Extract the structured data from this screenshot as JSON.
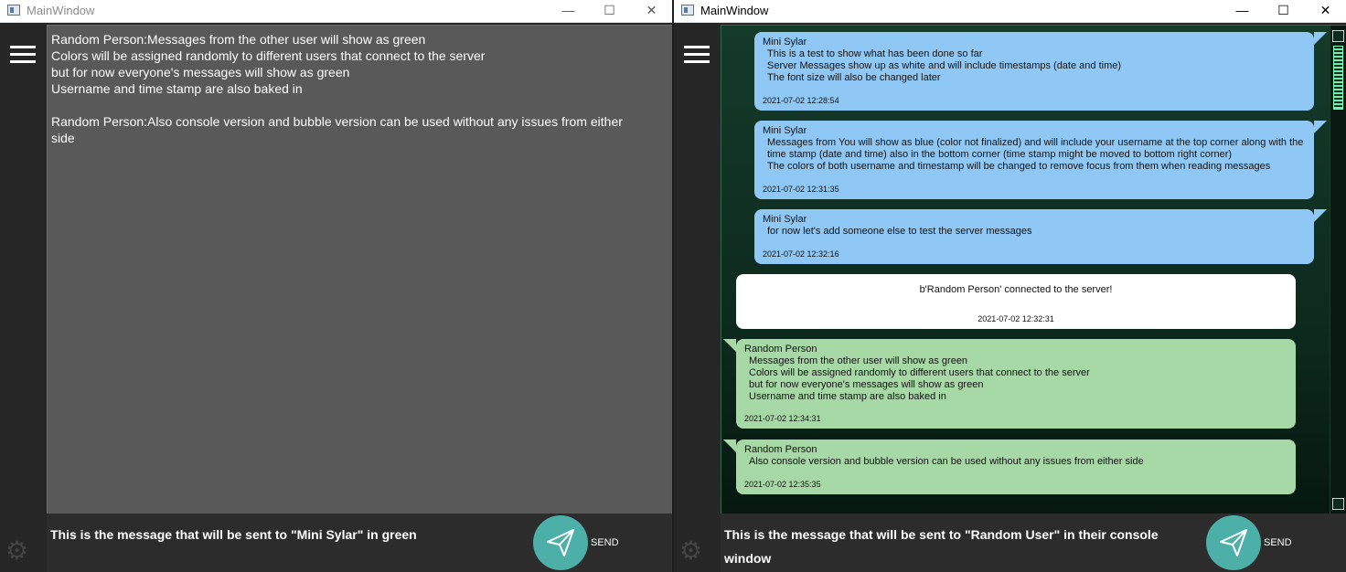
{
  "left_window": {
    "title": "MainWindow",
    "controls": {
      "minimize": "—",
      "maximize": "☐",
      "close": "✕"
    },
    "chat_lines": [
      "Random Person:Messages from the other user will show as green",
      "Colors will be assigned randomly to different users that connect to the server",
      "but for now everyone's messages will show as green",
      "Username and time stamp are also baked in",
      "",
      "Random Person:Also console version and bubble version can be used without any issues from either",
      "side"
    ],
    "input_text": "This is the message that will be sent to \"Mini Sylar\" in green",
    "send_label": "SEND"
  },
  "right_window": {
    "title": "MainWindow",
    "controls": {
      "minimize": "—",
      "maximize": "☐",
      "close": "✕"
    },
    "messages": [
      {
        "type": "own",
        "username": "Mini Sylar",
        "lines": [
          "This is a test to show what has been done so far",
          "Server Messages show up as white and will include timestamps (date and time)",
          "The font size will also be changed later"
        ],
        "timestamp": "2021-07-02 12:28:54"
      },
      {
        "type": "own",
        "username": "Mini Sylar",
        "lines": [
          "Messages from You will show as blue (color not finalized) and will include your username at the top corner along with the",
          "time stamp (date and time) also in the bottom corner (time stamp might be moved to bottom right corner)",
          "The colors of both username and timestamp will be changed to remove focus from them when reading messages"
        ],
        "timestamp": "2021-07-02 12:31:35"
      },
      {
        "type": "own",
        "username": "Mini Sylar",
        "lines": [
          "for now let's add someone else to test the server messages"
        ],
        "timestamp": "2021-07-02 12:32:16"
      },
      {
        "type": "server",
        "lines": [
          "b'Random Person' connected to the server!"
        ],
        "timestamp": "2021-07-02 12:32:31"
      },
      {
        "type": "other",
        "username": "Random Person",
        "lines": [
          "Messages from the other user will show as green",
          "Colors will be assigned randomly to different users that connect to the server",
          "but for now everyone's messages will show as green",
          "Username and time stamp are also baked in"
        ],
        "timestamp": "2021-07-02 12:34:31"
      },
      {
        "type": "other",
        "username": "Random Person",
        "lines": [
          "Also console version and bubble version can be used without any issues from either side"
        ],
        "timestamp": "2021-07-02 12:35:35"
      }
    ],
    "input_text_lines": [
      "This is the message that will be sent to \"Random User\" in their console",
      "window"
    ],
    "send_label": "SEND"
  },
  "colors": {
    "own_bubble": "#90c8f5",
    "other_bubble": "#a6d9a6",
    "server_bubble": "#ffffff",
    "send_button": "#4cb0a8"
  },
  "icons": [
    "app-window-icon",
    "hamburger-menu-icon",
    "settings-gear-icon",
    "send-paper-plane-icon"
  ]
}
